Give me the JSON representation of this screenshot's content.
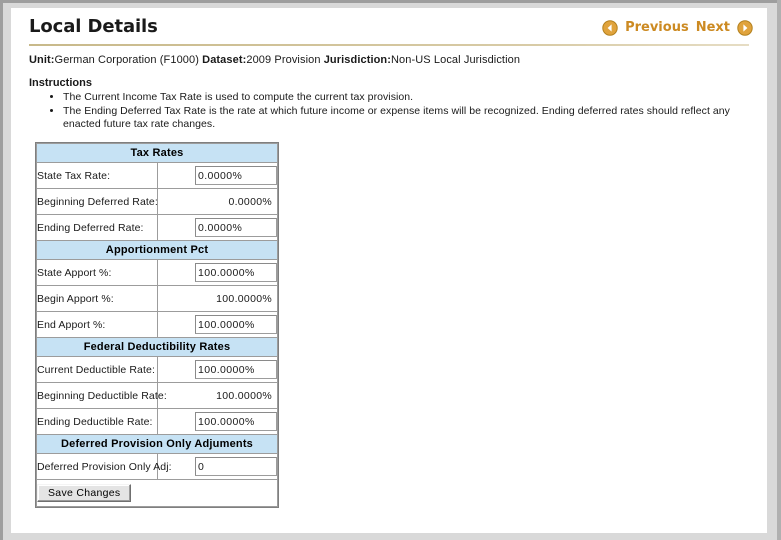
{
  "page": {
    "title": "Local Details"
  },
  "nav": {
    "previous_label": "Previous",
    "next_label": "Next",
    "prev_icon": "circle-arrow-left-icon",
    "next_icon": "circle-arrow-right-icon",
    "accent_color": "#cc8a22"
  },
  "meta": {
    "unit_label": "Unit:",
    "unit_value": "German Corporation (F1000)",
    "dataset_label": "Dataset:",
    "dataset_value": "2009 Provision",
    "jurisdiction_label": "Jurisdiction:",
    "jurisdiction_value": "Non-US Local Jurisdiction"
  },
  "instructions": {
    "heading": "Instructions",
    "items": [
      "The Current Income Tax Rate is used to compute the current tax provision.",
      "The Ending Deferred Tax Rate is the rate at which future income or expense items will be recognized. Ending deferred rates should reflect any enacted future tax rate changes."
    ]
  },
  "form": {
    "header_color": "#c6e2f4",
    "sections": [
      {
        "header": "Tax Rates",
        "rows": [
          {
            "label": "State Tax Rate:",
            "value": "0.0000%",
            "editable": true
          },
          {
            "label": "Beginning Deferred Rate:",
            "value": "0.0000%",
            "editable": false
          },
          {
            "label": "Ending Deferred Rate:",
            "value": "0.0000%",
            "editable": true
          }
        ]
      },
      {
        "header": "Apportionment Pct",
        "rows": [
          {
            "label": "State Apport %:",
            "value": "100.0000%",
            "editable": true
          },
          {
            "label": "Begin Apport %:",
            "value": "100.0000%",
            "editable": false
          },
          {
            "label": "End Apport %:",
            "value": "100.0000%",
            "editable": true
          }
        ]
      },
      {
        "header": "Federal Deductibility Rates",
        "rows": [
          {
            "label": "Current Deductible Rate:",
            "value": "100.0000%",
            "editable": true
          },
          {
            "label": "Beginning Deductible Rate:",
            "value": "100.0000%",
            "editable": false
          },
          {
            "label": "Ending Deductible Rate:",
            "value": "100.0000%",
            "editable": true
          }
        ]
      },
      {
        "header": "Deferred Provision Only Adjuments",
        "rows": [
          {
            "label": "Deferred Provision Only Adj:",
            "value": "0",
            "editable": true
          }
        ]
      }
    ],
    "save_label": "Save Changes"
  }
}
